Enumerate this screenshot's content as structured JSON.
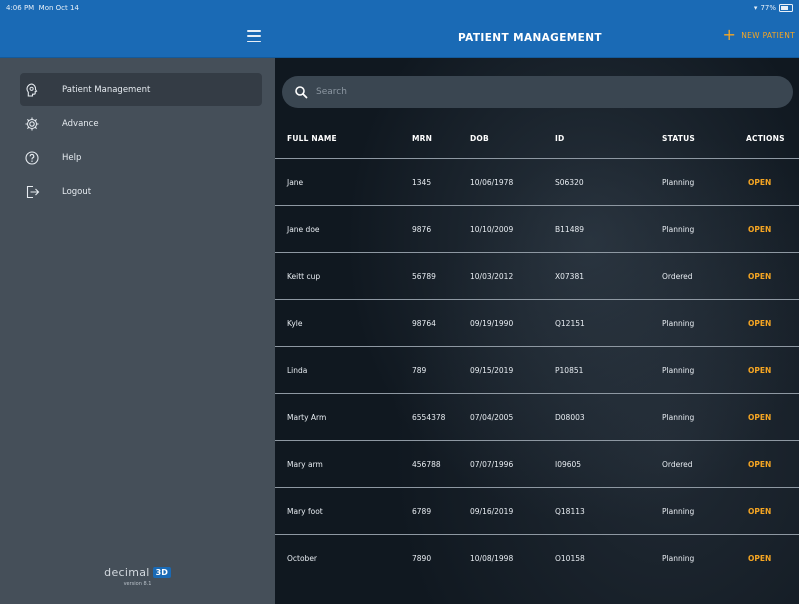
{
  "status_bar": {
    "time": "4:06 PM",
    "date": "Mon Oct 14",
    "battery": "77%"
  },
  "sidebar": {
    "menu_icon": "hamburger-icon",
    "items": [
      {
        "label": "Patient Management",
        "icon": "head-icon",
        "active": true
      },
      {
        "label": "Advance",
        "icon": "gear-icon",
        "active": false
      },
      {
        "label": "Help",
        "icon": "help-icon",
        "active": false
      },
      {
        "label": "Logout",
        "icon": "logout-icon",
        "active": false
      }
    ],
    "brand": {
      "name": "decimal",
      "badge": "3D",
      "version": "version 8.1"
    }
  },
  "header": {
    "title": "PATIENT MANAGEMENT",
    "new_patient_label": "NEW PATIENT"
  },
  "search": {
    "placeholder": "Search"
  },
  "table": {
    "columns": [
      "FULL NAME",
      "MRN",
      "DOB",
      "ID",
      "STATUS",
      "ACTIONS"
    ],
    "rows": [
      {
        "name": "Jane",
        "mrn": "1345",
        "dob": "10/06/1978",
        "id": "S06320",
        "status": "Planning",
        "action": "OPEN"
      },
      {
        "name": "Jane doe",
        "mrn": "9876",
        "dob": "10/10/2009",
        "id": "B11489",
        "status": "Planning",
        "action": "OPEN"
      },
      {
        "name": "Keitt cup",
        "mrn": "56789",
        "dob": "10/03/2012",
        "id": "X07381",
        "status": "Ordered",
        "action": "OPEN"
      },
      {
        "name": "Kyle",
        "mrn": "98764",
        "dob": "09/19/1990",
        "id": "Q12151",
        "status": "Planning",
        "action": "OPEN"
      },
      {
        "name": "Linda",
        "mrn": "789",
        "dob": "09/15/2019",
        "id": "P10851",
        "status": "Planning",
        "action": "OPEN"
      },
      {
        "name": "Marty Arm",
        "mrn": "6554378",
        "dob": "07/04/2005",
        "id": "D08003",
        "status": "Planning",
        "action": "OPEN"
      },
      {
        "name": "Mary arm",
        "mrn": "456788",
        "dob": "07/07/1996",
        "id": "I09605",
        "status": "Ordered",
        "action": "OPEN"
      },
      {
        "name": "Mary foot",
        "mrn": "6789",
        "dob": "09/16/2019",
        "id": "Q18113",
        "status": "Planning",
        "action": "OPEN"
      },
      {
        "name": "October",
        "mrn": "7890",
        "dob": "10/08/1998",
        "id": "O10158",
        "status": "Planning",
        "action": "OPEN"
      }
    ]
  },
  "colors": {
    "header_blue": "#1a6ab5",
    "sidebar_gray": "#454f59",
    "accent_orange": "#f6a623"
  }
}
